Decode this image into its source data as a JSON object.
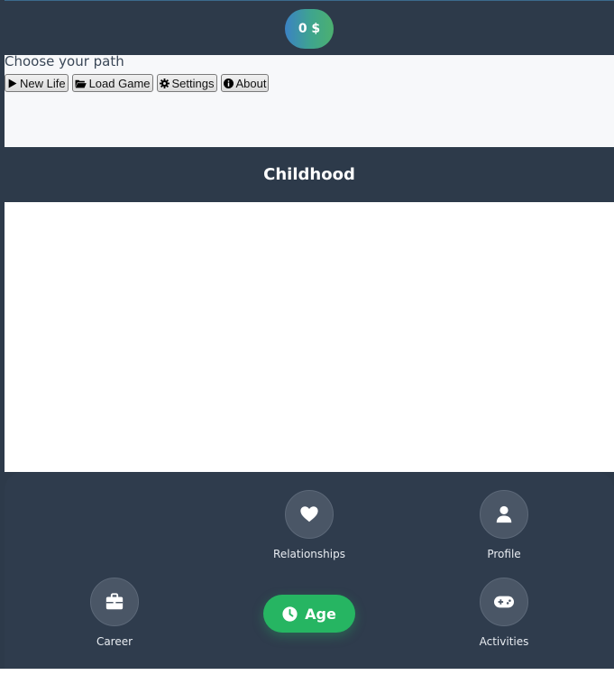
{
  "header": {
    "money": "0 $"
  },
  "menu": {
    "tagline": "Choose your path",
    "buttons": [
      {
        "label": "New Life",
        "icon": "play-icon"
      },
      {
        "label": "Load Game",
        "icon": "folder-open-icon"
      },
      {
        "label": "Settings",
        "icon": "gear-icon"
      },
      {
        "label": "About",
        "icon": "info-icon"
      }
    ]
  },
  "stage": {
    "title": "Childhood"
  },
  "nav": {
    "relationships": {
      "label": "Relationships",
      "icon": "heart-icon"
    },
    "profile": {
      "label": "Profile",
      "icon": "user-icon"
    },
    "career": {
      "label": "Career",
      "icon": "briefcase-icon"
    },
    "activities": {
      "label": "Activities",
      "icon": "gamepad-icon"
    },
    "age": {
      "label": "Age",
      "icon": "clock-icon"
    }
  },
  "colors": {
    "panel": "#2d3a4a",
    "age_green": "#26b562",
    "money_gradient_start": "#3b82c4",
    "money_gradient_end": "#4cb070"
  }
}
